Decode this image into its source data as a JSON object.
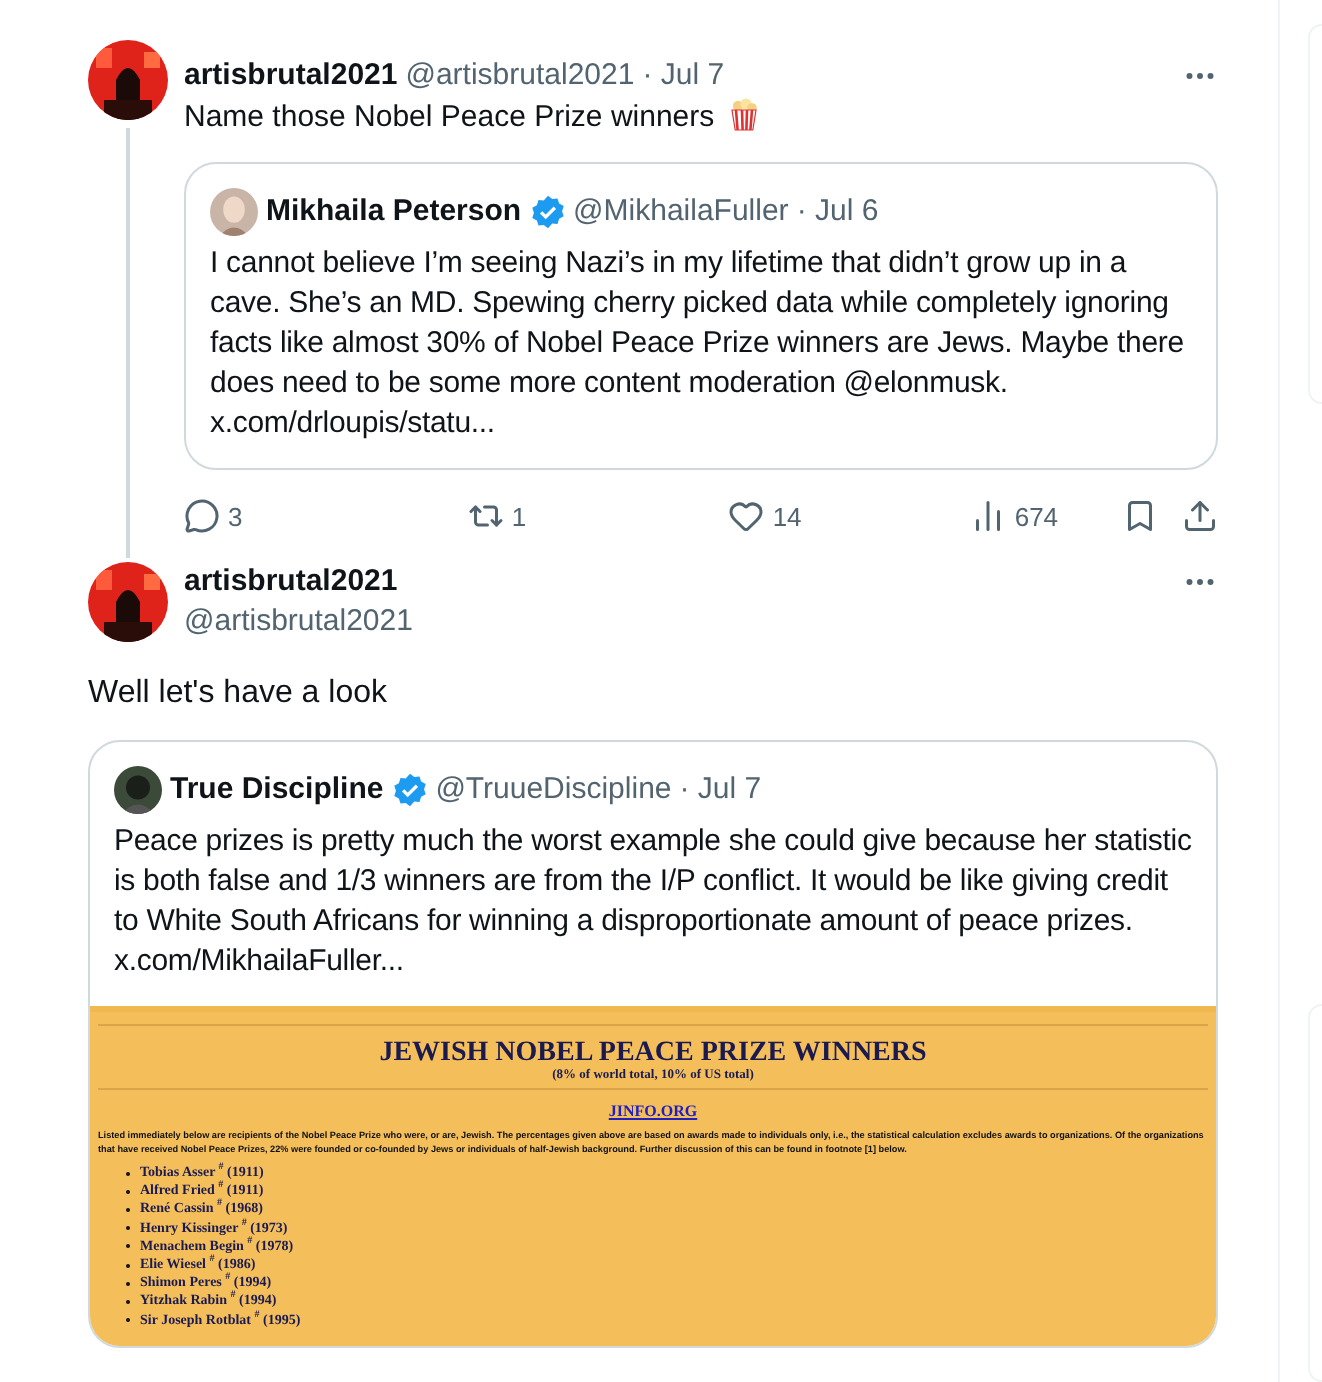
{
  "tweets": [
    {
      "kind": "inline",
      "thread_continues": true,
      "author": {
        "name": "artisbrutal2021",
        "handle": "@artisbrutal2021"
      },
      "date": "· Jul 7",
      "text": "Name those Nobel Peace Prize winners",
      "quote": {
        "author": {
          "name": "Mikhaila Peterson",
          "handle": "@MikhailaFuller",
          "verified": true
        },
        "date": "· Jul 6",
        "text": "I cannot believe I’m seeing Nazi’s in my lifetime that didn’t grow up in a cave. She’s an MD. Spewing cherry picked data while completely ignoring facts like almost 30% of Nobel Peace Prize winners are Jews. Maybe there does need to be some more content moderation @elonmusk. x.com/drloupis/statu..."
      },
      "stats": {
        "replies": "3",
        "reposts": "1",
        "likes": "14",
        "views": "674"
      }
    },
    {
      "kind": "stacked",
      "author": {
        "name": "artisbrutal2021",
        "handle": "@artisbrutal2021"
      },
      "text": "Well let's have a look",
      "quote": {
        "author": {
          "name": "True Discipline",
          "handle": "@TruueDiscipline",
          "verified": true
        },
        "date": "· Jul 7",
        "text": "Peace prizes is pretty much the worst example she could give because her statistic is both false and 1/3 winners are from the I/P conflict. It would be like giving credit to White South Africans for winning a disproportionate amount of peace prizes.  x.com/MikhailaFuller...",
        "document": {
          "title": "JEWISH NOBEL PEACE PRIZE WINNERS",
          "subtitle": "(8% of world total, 10% of US total)",
          "link": "JINFO.ORG",
          "intro": "Listed immediately below are recipients of the Nobel Peace Prize who were, or are, Jewish.  The percentages given above are based on awards made to individuals only, i.e., the statistical calculation excludes awards to organizations.  Of the organizations that have received Nobel Peace Prizes, 22% were founded or co-founded by Jews or individuals of half-Jewish background.  Further discussion of this can be found in footnote [1] below.",
          "entries": [
            "Tobias Asser $^{#}$ (1911)",
            "Alfred Fried $^{#}$ (1911)",
            "René Cassin $^{#}$ (1968)",
            "Henry  Kissinger $^{#}$ (1973)",
            "Menachem Begin $^{#}$ (1978)",
            "Elie Wiesel $^{#}$ (1986)",
            "Shimon Peres $^{#}$ (1994)",
            "Yitzhak Rabin $^{#}$ (1994)",
            "Sir Joseph Rotblat $^{#}$ (1995)"
          ]
        }
      }
    }
  ]
}
